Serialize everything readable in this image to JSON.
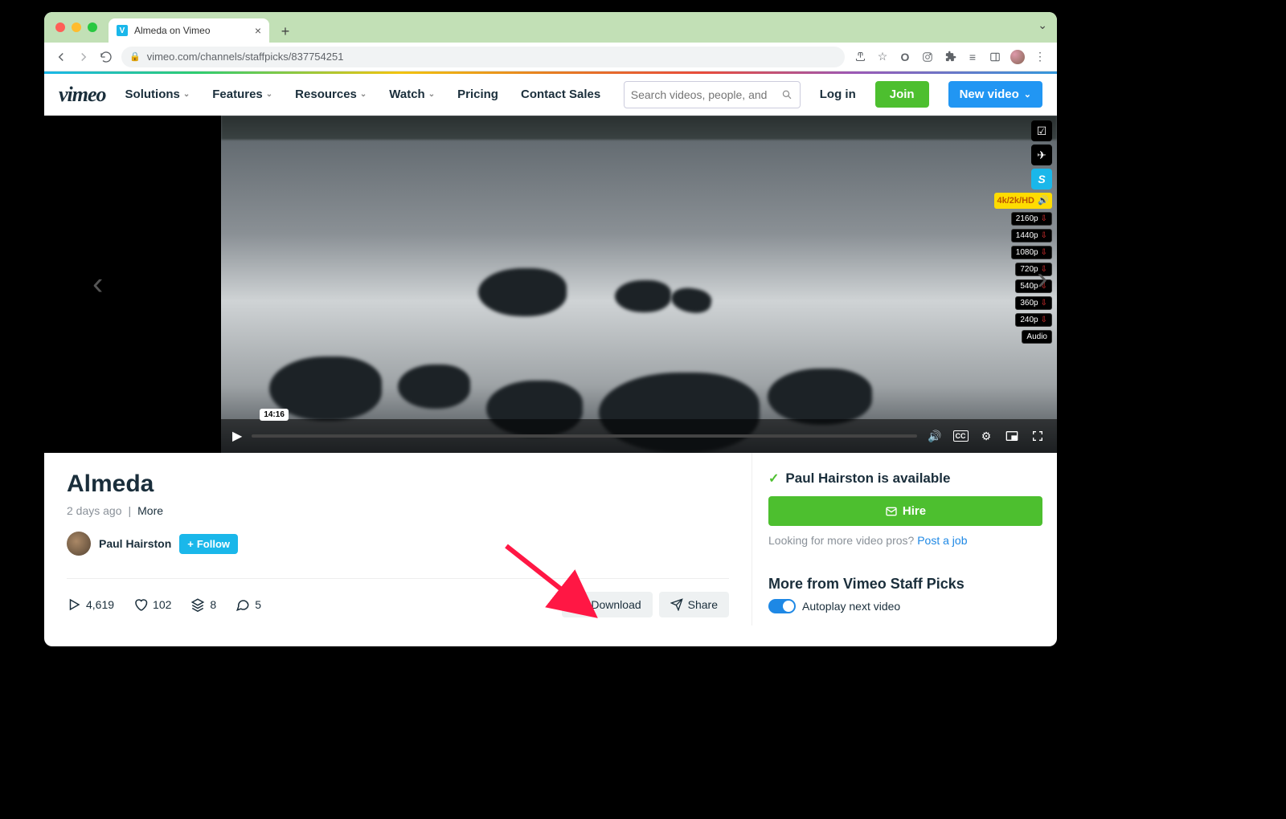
{
  "browser": {
    "tab_title": "Almeda on Vimeo",
    "url": "vimeo.com/channels/staffpicks/837754251"
  },
  "header": {
    "logo": "vimeo",
    "menu": [
      "Solutions",
      "Features",
      "Resources",
      "Watch",
      "Pricing",
      "Contact Sales"
    ],
    "menu_has_chevron": [
      true,
      true,
      true,
      true,
      false,
      false
    ],
    "search_placeholder": "Search videos, people, and",
    "login": "Log in",
    "join": "Join",
    "new_video": "New video"
  },
  "player": {
    "time_tooltip": "14:16",
    "hd_badge": "4k/2k/HD",
    "resolutions": [
      "2160p",
      "1440p",
      "1080p",
      "720p",
      "540p",
      "360p",
      "240p",
      "Audio"
    ]
  },
  "video": {
    "title": "Almeda",
    "age": "2 days ago",
    "more": "More",
    "author": "Paul Hairston",
    "follow": "Follow",
    "stats": {
      "plays": "4,619",
      "likes": "102",
      "collections": "8",
      "comments": "5"
    },
    "download": "Download",
    "share": "Share"
  },
  "sidebar": {
    "available_text": "Paul Hairston is available",
    "hire": "Hire",
    "looking": "Looking for more video pros? ",
    "post_job": "Post a job",
    "more_from": "More from Vimeo Staff Picks",
    "autoplay": "Autoplay next video"
  }
}
